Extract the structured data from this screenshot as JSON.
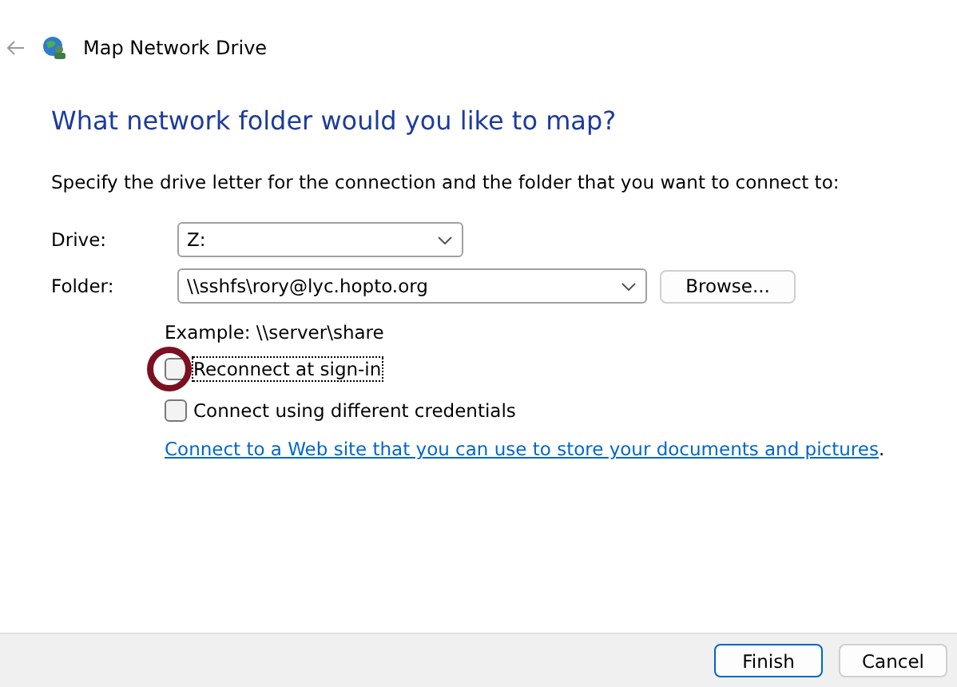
{
  "window": {
    "title": "Map Network Drive"
  },
  "heading": "What network folder would you like to map?",
  "instructions": "Specify the drive letter for the connection and the folder that you want to connect to:",
  "drive": {
    "label": "Drive:",
    "value": "Z:"
  },
  "folder": {
    "label": "Folder:",
    "value": "\\\\sshfs\\rory@lyc.hopto.org",
    "browse": "Browse..."
  },
  "example": "Example: \\\\server\\share",
  "options": [
    {
      "label": "Reconnect at sign-in",
      "checked": false,
      "focused": true,
      "highlighted": true
    },
    {
      "label": "Connect using different credentials",
      "checked": false,
      "focused": false,
      "highlighted": false
    }
  ],
  "link": "Connect to a Web site that you can use to store your documents and pictures",
  "link_suffix": ".",
  "buttons": [
    {
      "label": "Finish",
      "default": true
    },
    {
      "label": "Cancel",
      "default": false
    }
  ]
}
